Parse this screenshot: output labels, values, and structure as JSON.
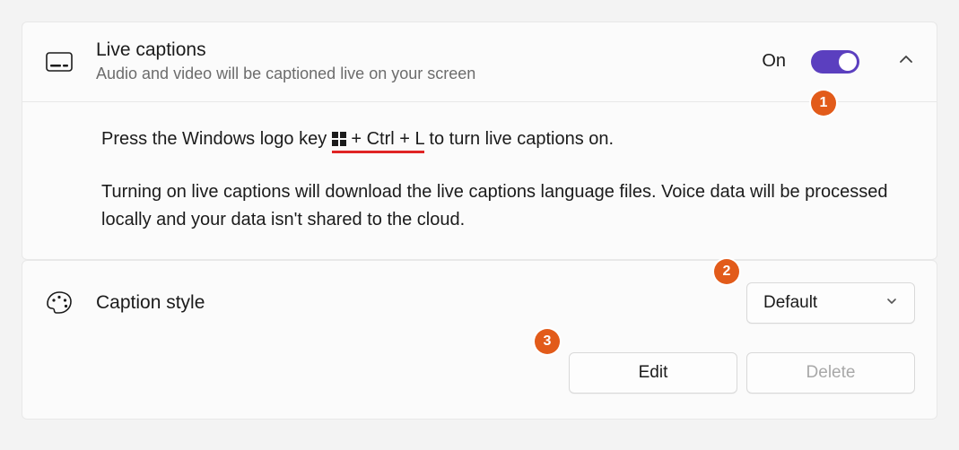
{
  "liveCaptions": {
    "title": "Live captions",
    "subtitle": "Audio and video will be captioned live on your screen",
    "stateLabel": "On",
    "pressPrefix": "Press the Windows logo key ",
    "shortcut": " + Ctrl + L",
    "pressSuffix": " to turn live captions on.",
    "downloadNote": "Turning on live captions will download the live captions language files. Voice data will be processed locally and your data isn't shared to the cloud."
  },
  "captionStyle": {
    "label": "Caption style",
    "selected": "Default",
    "editLabel": "Edit",
    "deleteLabel": "Delete"
  },
  "annotations": {
    "one": "1",
    "two": "2",
    "three": "3"
  }
}
